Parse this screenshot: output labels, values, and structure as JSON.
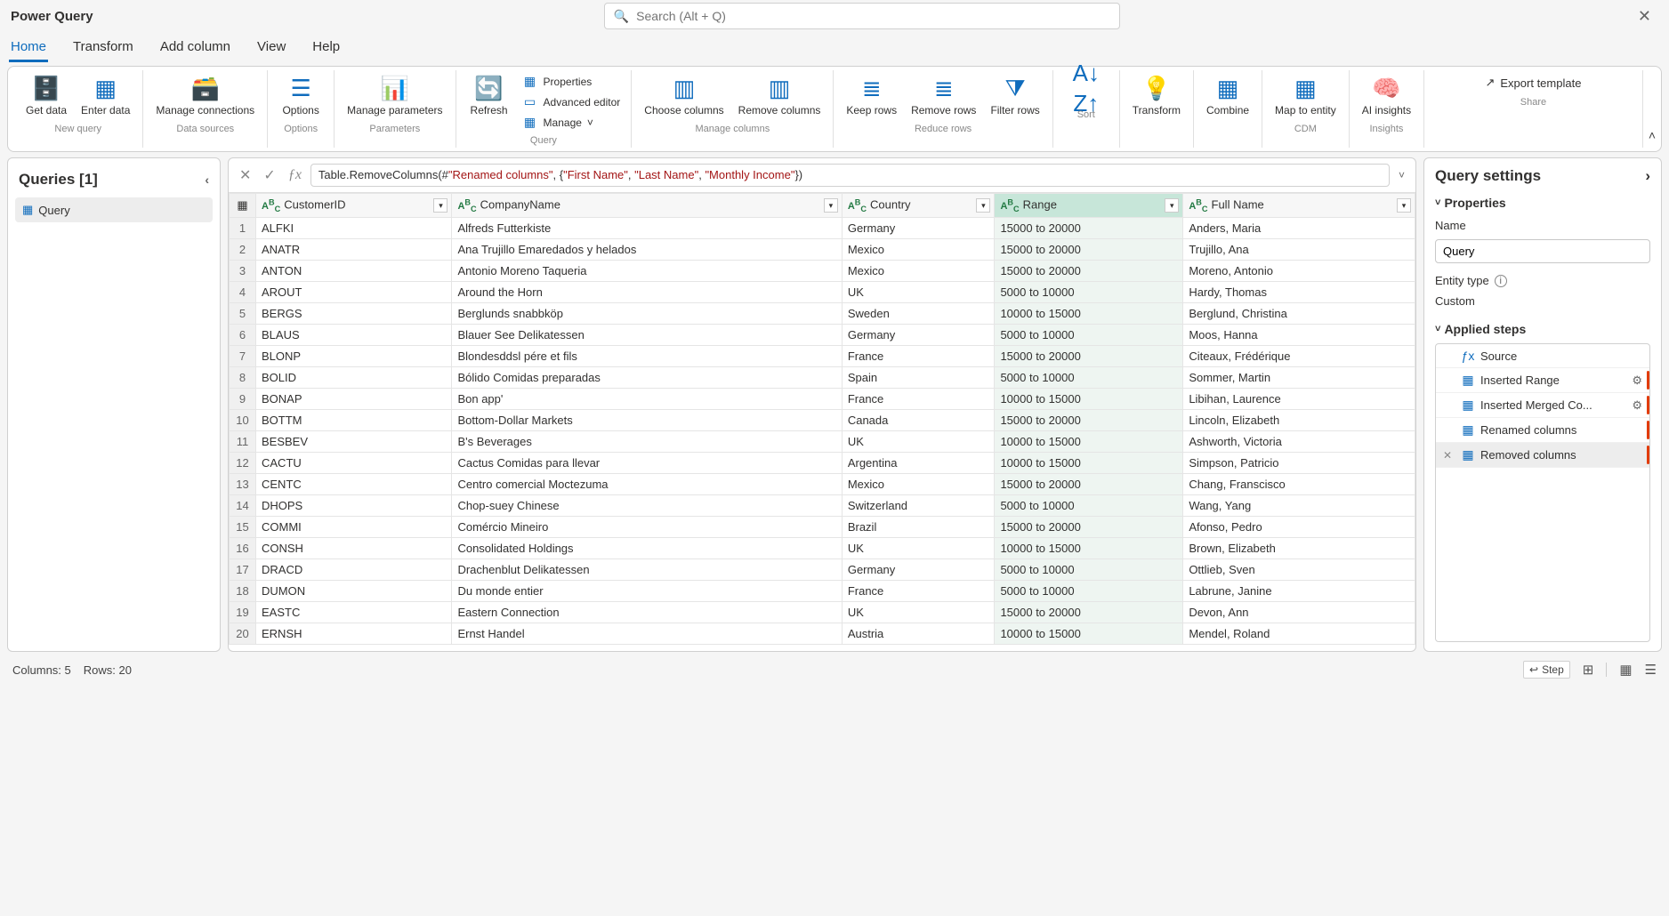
{
  "app_title": "Power Query",
  "search_placeholder": "Search (Alt + Q)",
  "menu": {
    "home": "Home",
    "transform": "Transform",
    "addcol": "Add column",
    "view": "View",
    "help": "Help"
  },
  "ribbon": {
    "get_data": "Get data",
    "enter_data": "Enter data",
    "new_query": "New query",
    "manage_conn": "Manage connections",
    "data_sources": "Data sources",
    "options": "Options",
    "options_grp": "Options",
    "manage_params": "Manage parameters",
    "parameters": "Parameters",
    "refresh": "Refresh",
    "properties": "Properties",
    "adv_editor": "Advanced editor",
    "manage": "Manage",
    "query": "Query",
    "choose_cols": "Choose columns",
    "remove_cols": "Remove columns",
    "manage_cols": "Manage columns",
    "keep_rows": "Keep rows",
    "remove_rows": "Remove rows",
    "filter_rows": "Filter rows",
    "reduce_rows": "Reduce rows",
    "sort": "Sort",
    "transform": "Transform",
    "combine": "Combine",
    "map_entity": "Map to entity",
    "cdm": "CDM",
    "ai": "AI insights",
    "insights": "Insights",
    "export": "Export template",
    "share": "Share"
  },
  "queries": {
    "title": "Queries [1]",
    "item": "Query"
  },
  "formula": {
    "prefix": "Table.RemoveColumns(#",
    "arg1": "\"Renamed columns\"",
    "mid": ", {",
    "s1": "\"First Name\"",
    "s2": "\"Last Name\"",
    "s3": "\"Monthly Income\"",
    "end": "})"
  },
  "columns": [
    "CustomerID",
    "CompanyName",
    "Country",
    "Range",
    "Full Name"
  ],
  "rows": [
    [
      "ALFKI",
      "Alfreds Futterkiste",
      "Germany",
      "15000 to 20000",
      "Anders, Maria"
    ],
    [
      "ANATR",
      "Ana Trujillo Emaredados y helados",
      "Mexico",
      "15000 to 20000",
      "Trujillo, Ana"
    ],
    [
      "ANTON",
      "Antonio Moreno Taqueria",
      "Mexico",
      "15000 to 20000",
      "Moreno, Antonio"
    ],
    [
      "AROUT",
      "Around the Horn",
      "UK",
      "5000 to 10000",
      "Hardy, Thomas"
    ],
    [
      "BERGS",
      "Berglunds snabbköp",
      "Sweden",
      "10000 to 15000",
      "Berglund, Christina"
    ],
    [
      "BLAUS",
      "Blauer See Delikatessen",
      "Germany",
      "5000 to 10000",
      "Moos, Hanna"
    ],
    [
      "BLONP",
      "Blondesddsl pére et fils",
      "France",
      "15000 to 20000",
      "Citeaux, Frédérique"
    ],
    [
      "BOLID",
      "Bólido Comidas preparadas",
      "Spain",
      "5000 to 10000",
      "Sommer, Martin"
    ],
    [
      "BONAP",
      "Bon app'",
      "France",
      "10000 to 15000",
      "Libihan, Laurence"
    ],
    [
      "BOTTM",
      "Bottom-Dollar Markets",
      "Canada",
      "15000 to 20000",
      "Lincoln, Elizabeth"
    ],
    [
      "BESBEV",
      "B's Beverages",
      "UK",
      "10000 to 15000",
      "Ashworth, Victoria"
    ],
    [
      "CACTU",
      "Cactus Comidas para llevar",
      "Argentina",
      "10000 to 15000",
      "Simpson, Patricio"
    ],
    [
      "CENTC",
      "Centro comercial Moctezuma",
      "Mexico",
      "15000 to 20000",
      "Chang, Franscisco"
    ],
    [
      "DHOPS",
      "Chop-suey Chinese",
      "Switzerland",
      "5000 to 10000",
      "Wang, Yang"
    ],
    [
      "COMMI",
      "Comércio Mineiro",
      "Brazil",
      "15000 to 20000",
      "Afonso, Pedro"
    ],
    [
      "CONSH",
      "Consolidated Holdings",
      "UK",
      "10000 to 15000",
      "Brown, Elizabeth"
    ],
    [
      "DRACD",
      "Drachenblut Delikatessen",
      "Germany",
      "5000 to 10000",
      "Ottlieb, Sven"
    ],
    [
      "DUMON",
      "Du monde entier",
      "France",
      "5000 to 10000",
      "Labrune, Janine"
    ],
    [
      "EASTC",
      "Eastern Connection",
      "UK",
      "15000 to 20000",
      "Devon, Ann"
    ],
    [
      "ERNSH",
      "Ernst Handel",
      "Austria",
      "10000 to 15000",
      "Mendel, Roland"
    ]
  ],
  "settings": {
    "title": "Query settings",
    "properties": "Properties",
    "name_label": "Name",
    "name_value": "Query",
    "entity_type_label": "Entity type",
    "entity_type_value": "Custom",
    "applied_steps": "Applied steps",
    "steps": [
      "Source",
      "Inserted Range",
      "Inserted Merged Co...",
      "Renamed columns",
      "Removed columns"
    ]
  },
  "status": {
    "cols": "Columns: 5",
    "rows": "Rows: 20",
    "step": "Step"
  }
}
